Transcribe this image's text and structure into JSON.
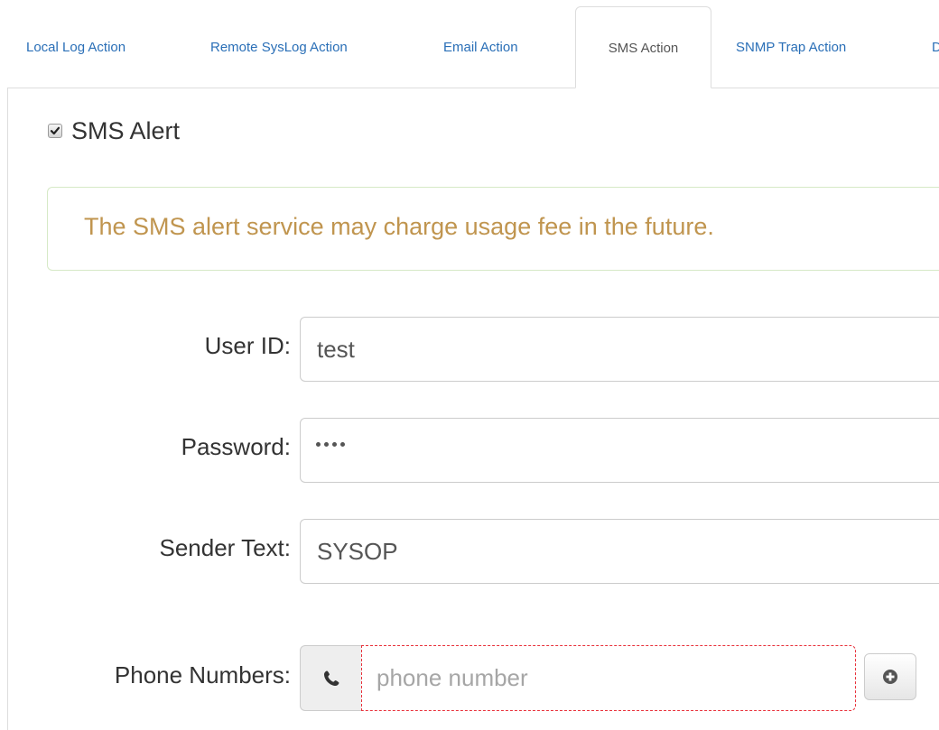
{
  "tabs": [
    {
      "label": "Local Log Action",
      "active": false
    },
    {
      "label": "Remote SysLog Action",
      "active": false
    },
    {
      "label": "Email Action",
      "active": false
    },
    {
      "label": "SMS Action",
      "active": true
    },
    {
      "label": "SNMP Trap Action",
      "active": false
    },
    {
      "label": "D",
      "active": false
    }
  ],
  "sms_alert": {
    "label": "SMS Alert",
    "checked": true
  },
  "alert": {
    "message": "The SMS alert service may charge usage fee in the future.",
    "text_color": "#c0954f",
    "border_color": "#d6e9c6"
  },
  "form": {
    "user_id": {
      "label": "User ID:",
      "value": "test"
    },
    "password": {
      "label": "Password:",
      "value": "••••"
    },
    "sender_text": {
      "label": "Sender Text:",
      "value": "SYSOP"
    },
    "phone_numbers": {
      "label": "Phone Numbers:",
      "placeholder": "phone number",
      "value": ""
    }
  },
  "icons": {
    "phone": "phone-icon",
    "add": "plus-circle-icon",
    "check": "checkmark-icon"
  },
  "colors": {
    "tab_link": "#2a6fb7",
    "invalid_border": "#e8303a"
  }
}
